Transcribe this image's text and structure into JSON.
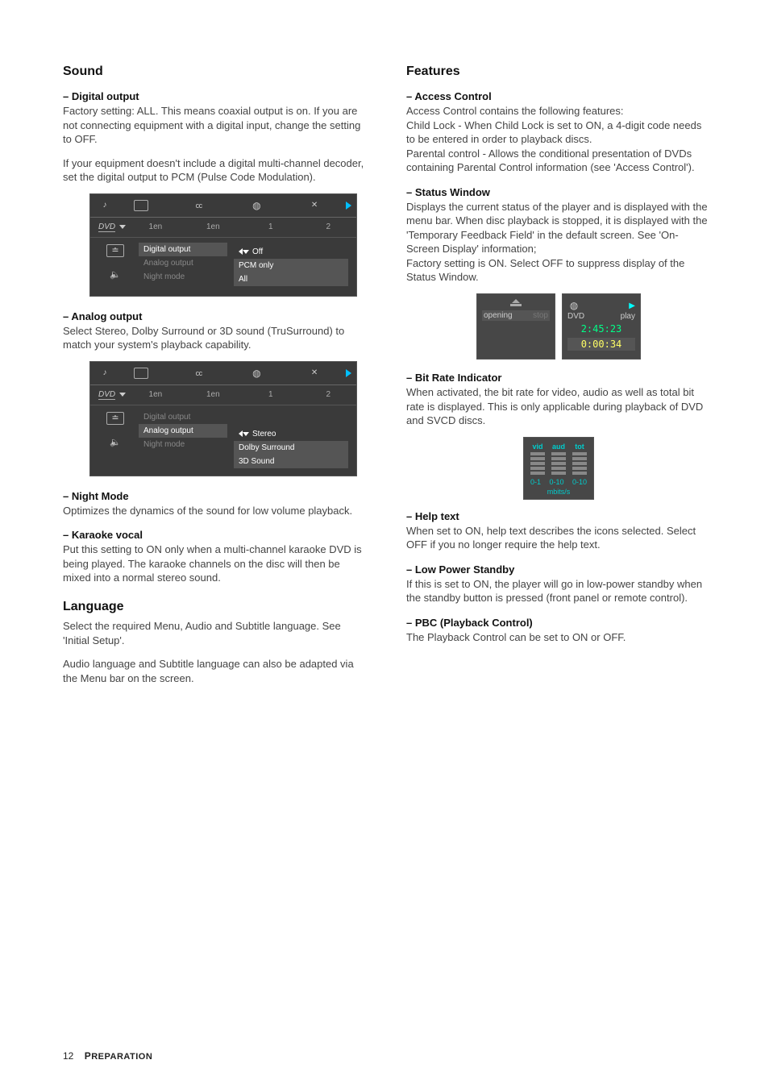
{
  "left": {
    "sound": {
      "heading": "Sound",
      "digital_output": {
        "title": "–   Digital output",
        "p1": "Factory setting: ALL. This means coaxial output is on. If you are not connecting equipment with a digital input, change the setting to OFF.",
        "p2": "If your equipment doesn't include a digital multi-channel decoder, set the digital output to PCM (Pulse Code Modulation)."
      },
      "analog_output": {
        "title": "–   Analog output",
        "p": "Select Stereo, Dolby Surround or 3D sound (TruSurround) to match your system's playback capability."
      },
      "night_mode": {
        "title": "–   Night Mode",
        "p": "Optimizes the dynamics of the sound for low volume playback."
      },
      "karaoke": {
        "title": "–   Karaoke vocal",
        "p": "Put this setting to ON only when a multi-channel karaoke DVD is being played. The karaoke channels on the disc will then be mixed into a normal stereo sound."
      }
    },
    "language": {
      "heading": "Language",
      "p1": "Select the required Menu, Audio and Subtitle language. See 'Initial Setup'.",
      "p2": "Audio language and Subtitle language can also be adapted via the Menu bar on the screen."
    },
    "osd1": {
      "status": {
        "dvd": "DVD",
        "c1": "1en",
        "c2": "1en",
        "c3": "1",
        "c4": "2"
      },
      "labels": {
        "digital": "Digital output",
        "analog": "Analog output",
        "night": "Night mode"
      },
      "opts": {
        "o1": "Off",
        "o2": "PCM only",
        "o3": "All"
      }
    },
    "osd2": {
      "status": {
        "dvd": "DVD",
        "c1": "1en",
        "c2": "1en",
        "c3": "1",
        "c4": "2"
      },
      "labels": {
        "digital": "Digital output",
        "analog": "Analog output",
        "night": "Night mode"
      },
      "opts": {
        "o1": "Stereo",
        "o2": "Dolby Surround",
        "o3": "3D Sound"
      }
    }
  },
  "right": {
    "features": {
      "heading": "Features",
      "access": {
        "title": "–   Access Control",
        "p1": "Access Control contains the following features:",
        "p2": "Child Lock - When Child Lock is set to ON, a 4-digit code needs to be entered in order to playback discs.",
        "p3": "Parental control - Allows the conditional presentation of DVDs containing Parental Control information (see 'Access Control')."
      },
      "status_window": {
        "title": "–   Status Window",
        "p1": "Displays the current status of the player and is displayed with the menu bar.  When disc playback is stopped, it is displayed with the 'Temporary Feedback Field' in the default screen. See 'On-Screen Display' information;",
        "p2": "Factory setting is ON. Select OFF to suppress display of the Status Window."
      },
      "bit_rate": {
        "title": "–   Bit Rate Indicator",
        "p": "When activated, the bit rate for video, audio as well as total bit rate is displayed. This is only applicable during playback of DVD and SVCD discs."
      },
      "help": {
        "title": "–   Help text",
        "p": "When set to ON, help text describes the icons selected. Select OFF if you no longer require the help text."
      },
      "lowpower": {
        "title": "–   Low Power Standby",
        "p": "If this is set to ON, the player will go in low-power standby when the standby button is pressed (front panel or remote control)."
      },
      "pbc": {
        "title": "–   PBC (Playback Control)",
        "p": "The Playback Control can be set to ON or OFF."
      }
    },
    "sw1": {
      "l": "opening",
      "r": "stop"
    },
    "sw2": {
      "dvd": "DVD",
      "play": "play",
      "t1": "2:45:23",
      "t2": "0:00:34"
    },
    "bri": {
      "c1": "vid",
      "c2": "aud",
      "c3": "tot",
      "r1": "0-1",
      "r2": "0-10",
      "r3": "0-10",
      "unit": "mbits/s"
    }
  },
  "footer": {
    "page": "12",
    "section_first": "P",
    "section_rest": "REPARATION"
  }
}
